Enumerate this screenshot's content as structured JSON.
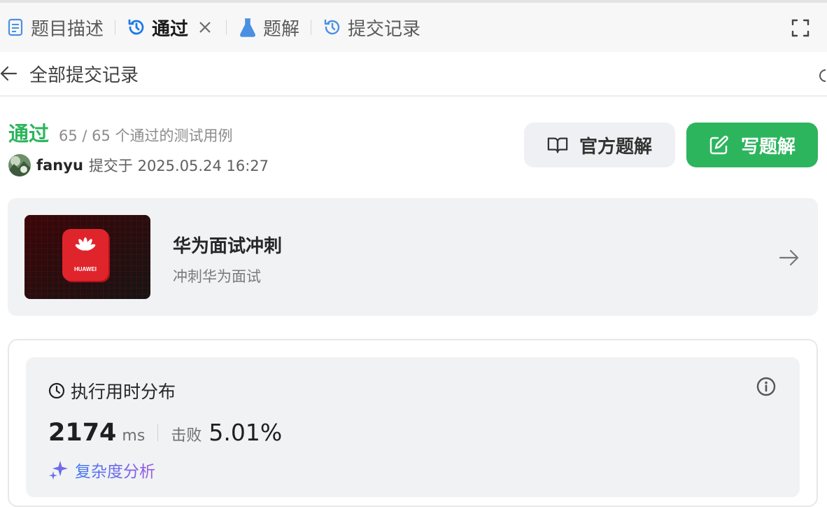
{
  "tabs": [
    {
      "label": "题目描述",
      "icon": "document-icon"
    },
    {
      "label": "通过",
      "icon": "history-icon",
      "active": true
    },
    {
      "label": "题解",
      "icon": "flask-icon"
    },
    {
      "label": "提交记录",
      "icon": "history-icon"
    }
  ],
  "back": {
    "label": "全部提交记录"
  },
  "submission": {
    "status": "通过",
    "status_color": "#2db55d",
    "testcases": "65 / 65 个通过的测试用例",
    "username": "fanyu",
    "submitted_text": "提交于 2025.05.24 16:27"
  },
  "buttons": {
    "official": "官方题解",
    "write": "写题解"
  },
  "promo": {
    "title": "华为面试冲刺",
    "subtitle": "冲刺华为面试",
    "logo_text": "HUAWEI"
  },
  "performance": {
    "title": "执行用时分布",
    "value": "2174",
    "unit": "ms",
    "beat_label": "击败",
    "beat_value": "5.01%",
    "complexity_label": "复杂度分析"
  }
}
